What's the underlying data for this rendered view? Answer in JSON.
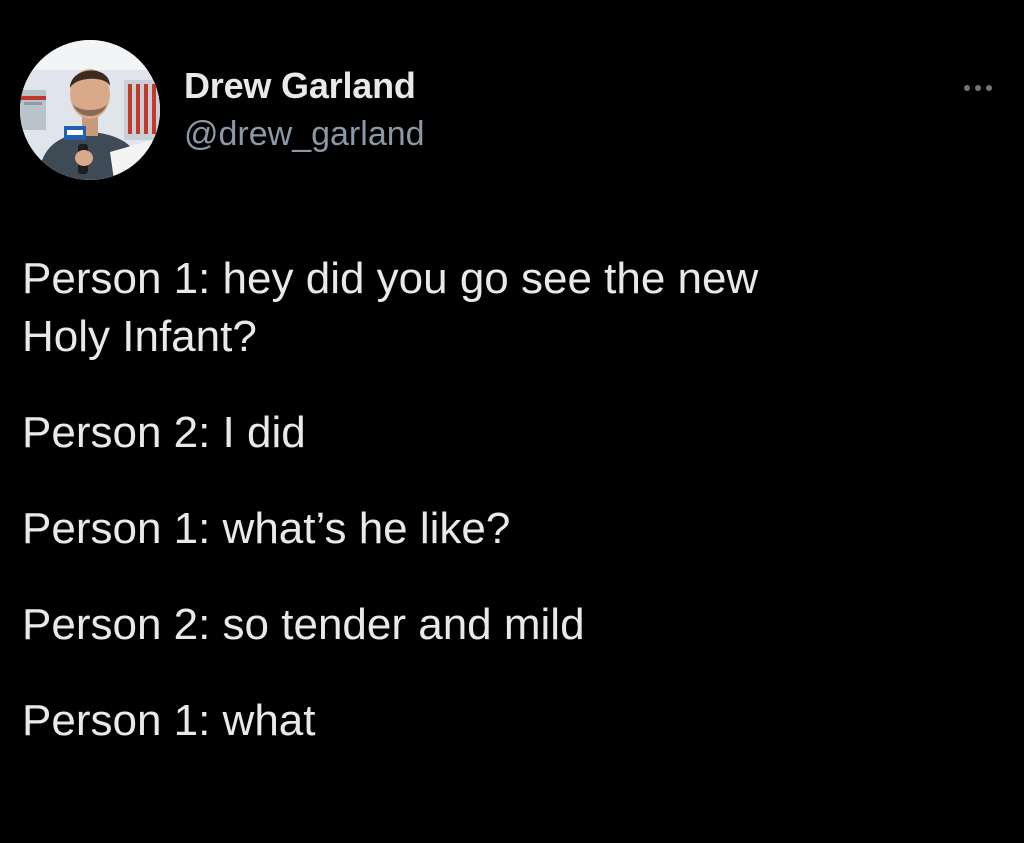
{
  "author": {
    "display_name": "Drew Garland",
    "handle": "@drew_garland",
    "avatar_icon": "person-photo-icon",
    "more_icon": "more-options-icon"
  },
  "tweet": {
    "lines": [
      "Person 1: hey did you go see the new",
      "Holy Infant?",
      "Person 2: I did",
      "Person 1: what’s he like?",
      "Person 2: so tender and mild",
      "Person 1: what"
    ]
  },
  "colors": {
    "background": "#000000",
    "primary_text": "#e7e9ea",
    "secondary_text": "#8b98a5"
  }
}
